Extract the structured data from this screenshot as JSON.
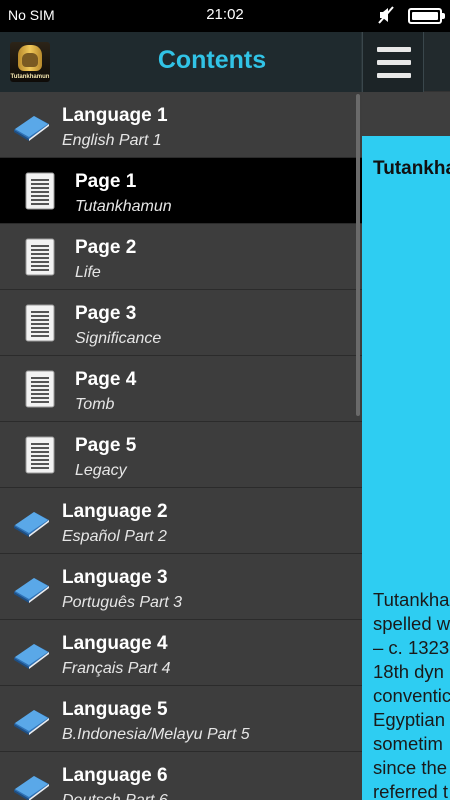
{
  "status_bar": {
    "carrier": "No SIM",
    "time": "21:02",
    "battery_level": 1.0
  },
  "drawer": {
    "title": "Contents",
    "logo_text": "Tutankhamun",
    "items": [
      {
        "type": "language",
        "label": "Language 1",
        "sub": "English Part 1",
        "icon": "book-icon"
      },
      {
        "type": "page",
        "label": "Page 1",
        "sub": "Tutankhamun",
        "icon": "document-icon",
        "selected": true
      },
      {
        "type": "page",
        "label": "Page 2",
        "sub": "Life",
        "icon": "document-icon"
      },
      {
        "type": "page",
        "label": "Page 3",
        "sub": "Significance",
        "icon": "document-icon"
      },
      {
        "type": "page",
        "label": "Page 4",
        "sub": "Tomb",
        "icon": "document-icon"
      },
      {
        "type": "page",
        "label": "Page 5",
        "sub": "Legacy",
        "icon": "document-icon"
      },
      {
        "type": "language",
        "label": "Language 2",
        "sub": "Español Part 2",
        "icon": "book-icon"
      },
      {
        "type": "language",
        "label": "Language 3",
        "sub": "Português Part 3",
        "icon": "book-icon"
      },
      {
        "type": "language",
        "label": "Language 4",
        "sub": "Français Part 4",
        "icon": "book-icon"
      },
      {
        "type": "language",
        "label": "Language 5",
        "sub": "B.Indonesia/Melayu Part 5",
        "icon": "book-icon"
      },
      {
        "type": "language",
        "label": "Language 6",
        "sub": "Deutsch Part 6",
        "icon": "book-icon"
      }
    ]
  },
  "content": {
    "title": "Tutankha",
    "body_lines": [
      "Tutankha",
      "spelled w",
      "– c. 1323",
      "18th dyn",
      "conventic",
      "Egyptian",
      "sometim",
      "since the",
      "referred t"
    ]
  },
  "colors": {
    "accent": "#31c3e6",
    "page_background": "#2ecdf2",
    "drawer_background": "#3d3d3d",
    "selected_item": "#000000"
  }
}
